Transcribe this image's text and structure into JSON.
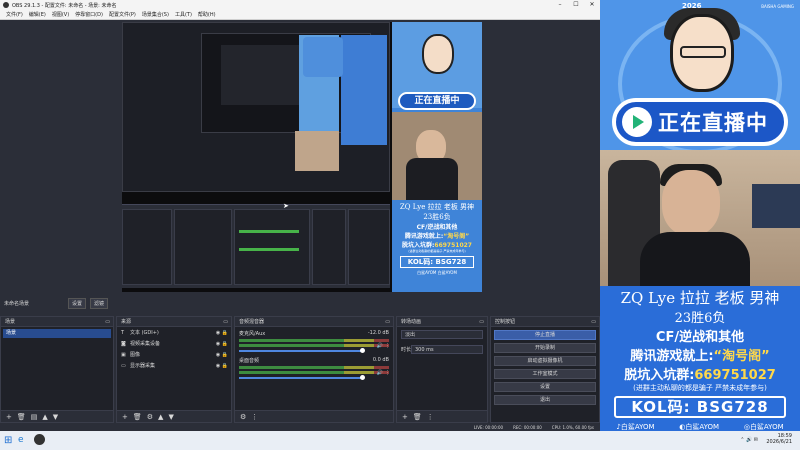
{
  "obs": {
    "title": "OBS 29.1.3 - 配置文件: 未命名 - 场景: 未命名",
    "menu": [
      "文件(F)",
      "编辑(E)",
      "视图(V)",
      "停靠窗口(D)",
      "配置文件(P)",
      "场景集合(S)",
      "工具(T)",
      "帮助(H)"
    ],
    "scene_label": "未命名场景",
    "scene_buttons": [
      "设置",
      "滤镜"
    ],
    "docks": {
      "scenes": {
        "title": "场景",
        "items": [
          "场景"
        ]
      },
      "sources": {
        "title": "来源",
        "items": [
          {
            "label": "文本 (GDI+)",
            "icon": "text-icon"
          },
          {
            "label": "视频采集设备",
            "icon": "camera-icon"
          },
          {
            "label": "图像",
            "icon": "image-icon"
          },
          {
            "label": "显示器采集",
            "icon": "monitor-icon"
          }
        ]
      },
      "mixer": {
        "title": "音频混音器",
        "channels": [
          {
            "name": "麦克风/Aux",
            "db": "-12.0 dB"
          },
          {
            "name": "桌面音频",
            "db": "0.0 dB"
          }
        ]
      },
      "transitions": {
        "title": "转场动画",
        "type": "淡出",
        "duration_label": "时长",
        "duration": "300 ms"
      },
      "controls": {
        "title": "控制按钮",
        "buttons": [
          "停止直播",
          "开始录制",
          "启动虚拟摄像机",
          "工作室模式",
          "设置",
          "退出"
        ]
      }
    },
    "status": {
      "live": "LIVE: 00:00:00",
      "rec": "REC: 00:00:00",
      "cpu": "CPU: 1.0%, 60.00 fps"
    }
  },
  "taskbar": {
    "time": "18:59",
    "date": "2026/6/21"
  },
  "stream": {
    "year": "2026",
    "brand": "BAISHA GAMING",
    "live_text": "正在直播中",
    "name_line": "ZQ Lye 拉拉 老板 男神",
    "record": "23胜6负",
    "games": "CF/逆战和其他",
    "search_prefix": "腾讯游戏就上:",
    "search_highlight": "“淘号阁”",
    "group_prefix": "脱坑入坑群:",
    "group_number": "669751027",
    "note": "(进群主动私聊的都是骗子 严禁未成年参与)",
    "kol": "KOL码: BSG728",
    "footer": [
      "白鲨AYOM",
      "白鲨AYOM",
      "白鲨AYOM"
    ],
    "small_name": "ZQ Lye 拉拉 老板 男神",
    "small_record": "23胜6负"
  },
  "colors": {
    "accent": "#2a6dd8",
    "obs_bg": "#2b2e38",
    "live_green": "#22b377",
    "highlight": "#ffd84a"
  }
}
